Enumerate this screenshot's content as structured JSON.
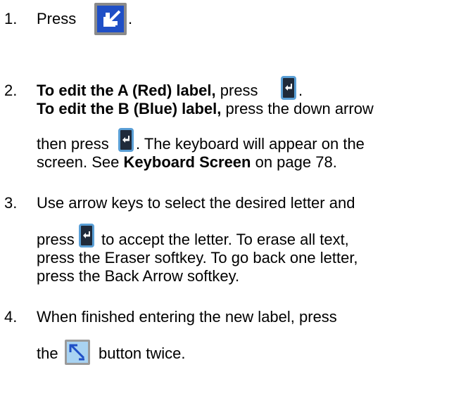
{
  "steps": [
    {
      "number": "1.",
      "text_before": "Press",
      "text_after": "."
    },
    {
      "number": "2.",
      "line1_bold": "To edit the A (Red) label,",
      "line1_rest": " press",
      "line1_end": ".",
      "line2_bold": "To edit the B (Blue) label,",
      "line2_rest": " press the down arrow",
      "line3_before": "then press",
      "line3_after": ". The keyboard will appear on the",
      "line4_before": "screen. See ",
      "line4_bold": "Keyboard Screen",
      "line4_after": " on page 78."
    },
    {
      "number": "3.",
      "line1": "Use arrow keys to select the desired letter and",
      "line2_before": "press",
      "line2_after": "to accept the letter. To erase all text,",
      "line3": "press the Eraser softkey. To go back one letter,",
      "line4": "press the Back Arrow softkey."
    },
    {
      "number": "4.",
      "line1": "When finished entering the new label, press",
      "line2_before": "the",
      "line2_after": "button twice."
    }
  ],
  "icons": {
    "edit_key": "edit-key-icon",
    "enter_key": "enter-key-icon",
    "setup_key": "setup-exit-key-icon"
  },
  "colors": {
    "edit_key": "#1f4fc6",
    "enter_key": "#1f2a3a",
    "setup_key": "#a9d3f2"
  }
}
